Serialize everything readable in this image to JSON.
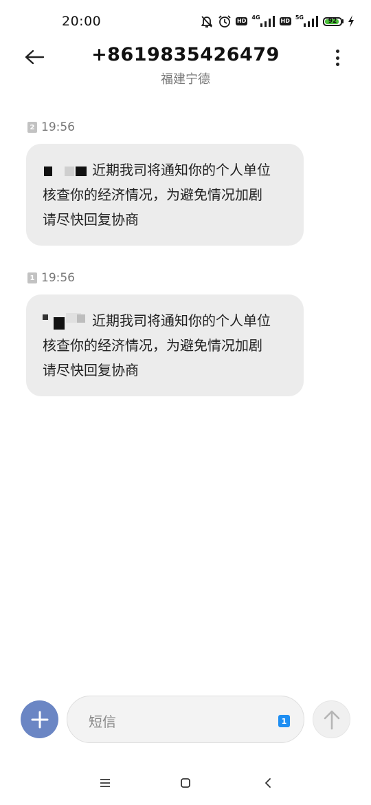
{
  "status_bar": {
    "time": "20:00",
    "network_1": "4G",
    "network_2": "5G",
    "hd_label": "HD",
    "battery_level": "92",
    "battery_fraction": 0.92,
    "battery_color": "#4cc13b",
    "icons": [
      "mute-bell-icon",
      "alarm-icon",
      "hd-icon",
      "signal-icon",
      "hd-icon",
      "signal-icon",
      "battery-icon",
      "charging-icon"
    ]
  },
  "header": {
    "number": "+8619835426479",
    "location": "福建宁德",
    "back_icon": "arrow-left-icon",
    "more_icon": "more-vertical-icon"
  },
  "messages": [
    {
      "sim": "2",
      "time": "19:56",
      "line1": "近期我司将通知你的个人单位",
      "line2": "核查你的经济情况，为避免情况加剧",
      "line3": "请尽快回复协商"
    },
    {
      "sim": "1",
      "time": "19:56",
      "line1": "近期我司将通知你的个人单位",
      "line2": "核查你的经济情况，为避免情况加剧",
      "line3": "请尽快回复协商"
    }
  ],
  "composer": {
    "placeholder": "短信",
    "sim": "1",
    "add_icon": "plus-icon",
    "send_icon": "arrow-up-icon",
    "accent": "#6b86c4",
    "sim_color": "#1e8ef2"
  },
  "nav": {
    "menu_icon": "menu-icon",
    "home_icon": "square-icon",
    "back_icon": "chevron-left-icon"
  }
}
